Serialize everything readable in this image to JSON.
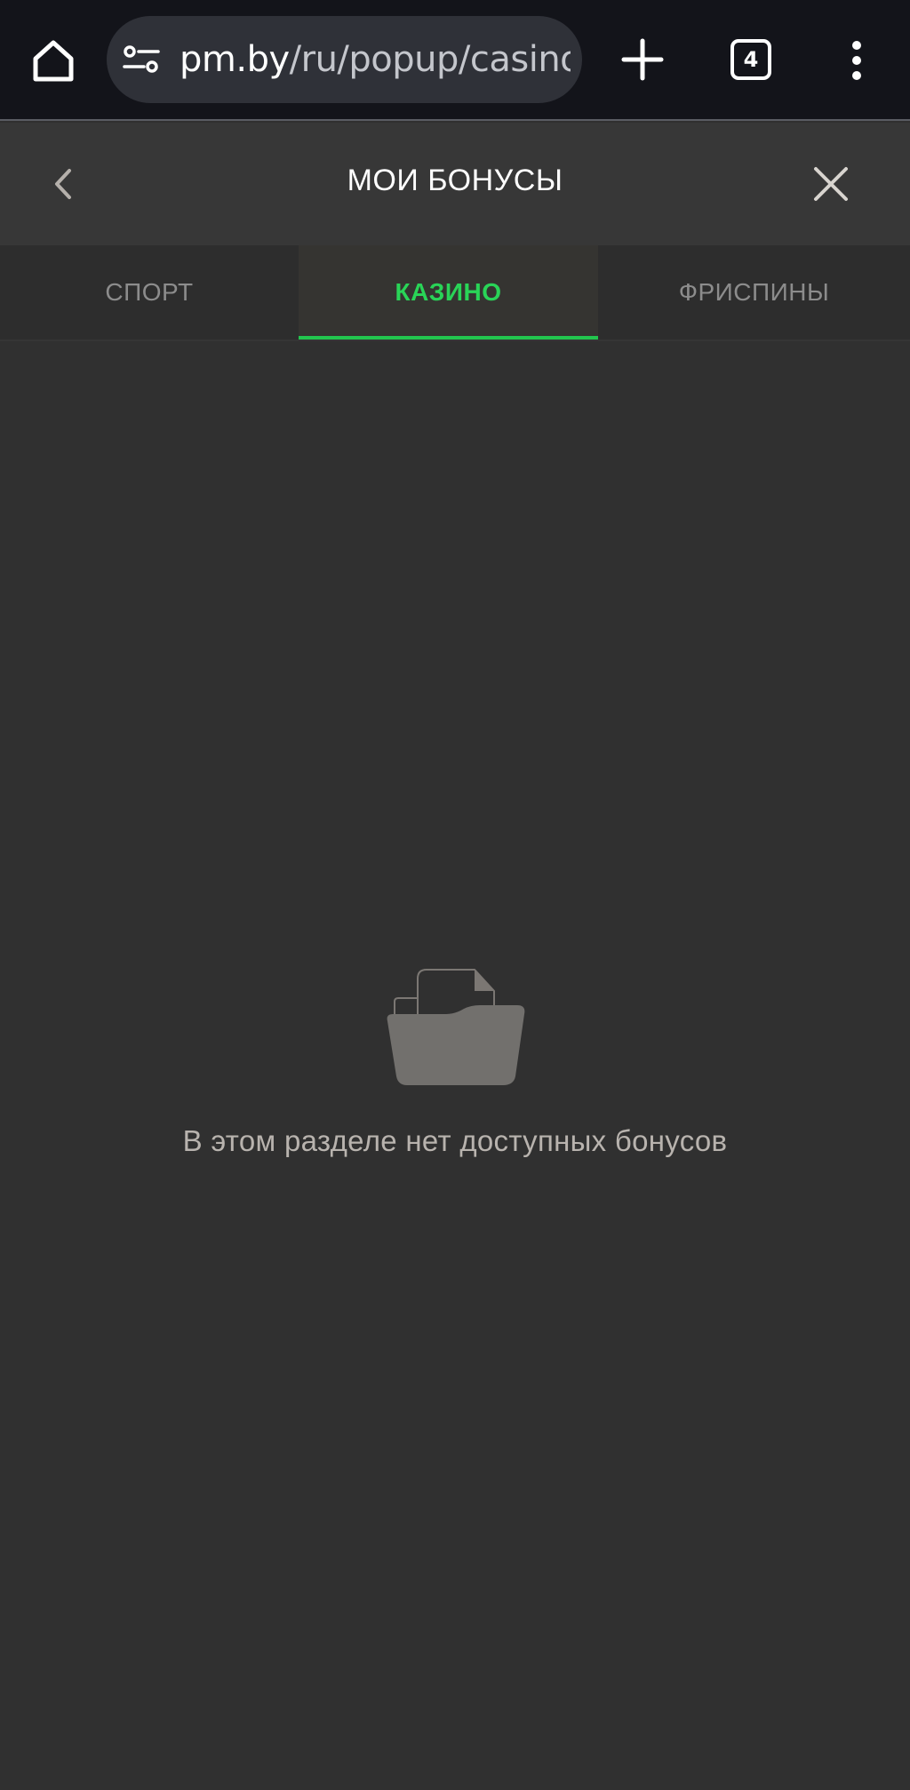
{
  "browser": {
    "url_host": "pm.by",
    "url_path": "/ru/popup/casinob",
    "tab_count": "4",
    "icons": [
      "home-icon",
      "site-settings-icon",
      "plus-icon",
      "tabs-icon",
      "more-vert-icon"
    ]
  },
  "popup": {
    "title": "МОИ БОНУСЫ",
    "icons": [
      "chevron-left-icon",
      "close-icon"
    ]
  },
  "tabs": [
    {
      "label": "СПОРТ",
      "active": false
    },
    {
      "label": "КАЗИНО",
      "active": true
    },
    {
      "label": "ФРИСПИНЫ",
      "active": false
    }
  ],
  "empty_state": {
    "icon": "empty-folder-icon",
    "message": "В этом разделе нет доступных бонусов"
  },
  "colors": {
    "accent": "#22c54e",
    "background": "#303030",
    "header": "#373737",
    "browser_bar": "#13141a"
  }
}
